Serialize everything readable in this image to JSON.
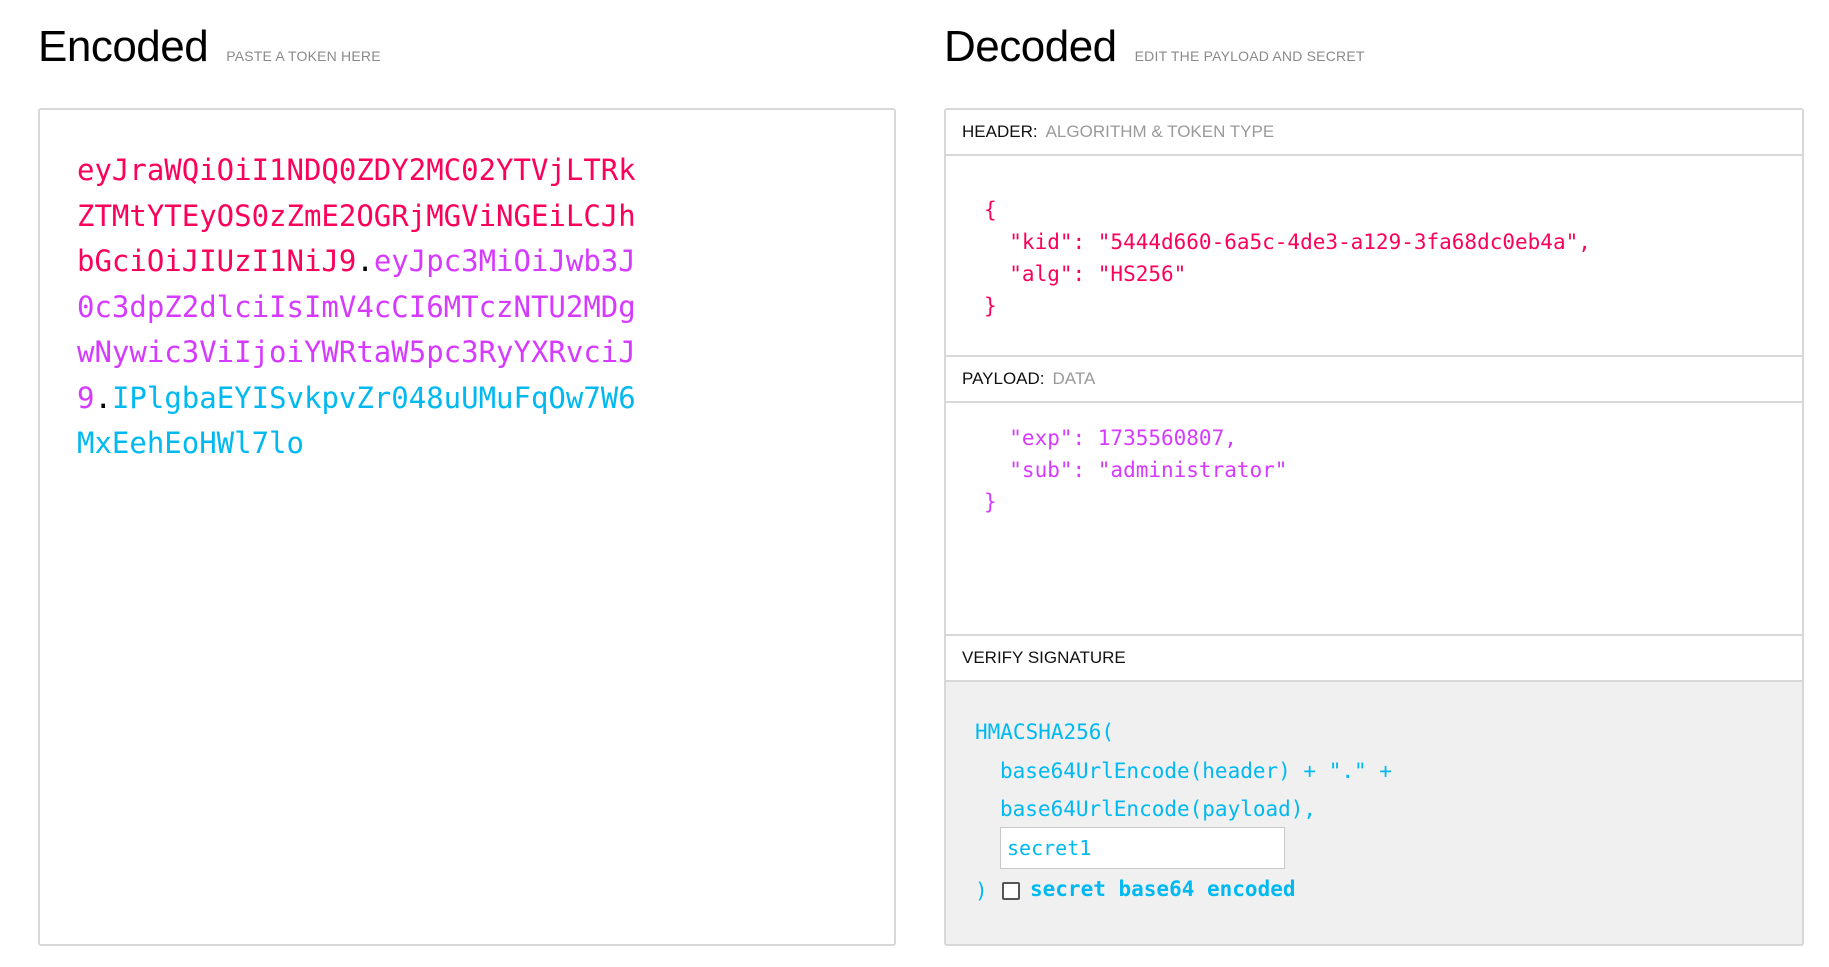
{
  "encoded": {
    "title": "Encoded",
    "subtitle": "PASTE A TOKEN HERE",
    "token": {
      "header": "eyJraWQiOiI1NDQ0ZDY2MC02YTVjLTRkZTMtYTEyOS0zZmE2OGRjMGViNGEiLCJhbGciOiJIUzI1NiJ9",
      "dot1": ".",
      "payload": "eyJpc3MiOiJwb3J0c3dpZ2dlciIsImV4cCI6MTczNTU2MDgwNywic3ViIjoiYWRtaW5pc3RyYXRvciJ9",
      "dot2": ".",
      "signature": "IPlgbaEYISvkpvZr048uUMuFqOw7W6MxEehEoHWl7lo"
    }
  },
  "decoded": {
    "title": "Decoded",
    "subtitle": "EDIT THE PAYLOAD AND SECRET",
    "header_section": {
      "label": "HEADER:",
      "sublabel": "ALGORITHM & TOKEN TYPE",
      "json": "{\n  \"kid\": \"5444d660-6a5c-4de3-a129-3fa68dc0eb4a\",\n  \"alg\": \"HS256\"\n}"
    },
    "payload_section": {
      "label": "PAYLOAD:",
      "sublabel": "DATA",
      "json": "  \"exp\": 1735560807,\n  \"sub\": \"administrator\"\n}"
    },
    "verify_section": {
      "label": "VERIFY SIGNATURE",
      "line1": "HMACSHA256(",
      "line2": "base64UrlEncode(header) + \".\" +",
      "line3": "base64UrlEncode(payload),",
      "secret_value": "secret1",
      "close": ")",
      "checkbox_label": "secret base64 encoded",
      "checkbox_checked": false
    }
  },
  "colors": {
    "header": "#fb015b",
    "payload": "#d63aff",
    "signature": "#00b9f1"
  }
}
